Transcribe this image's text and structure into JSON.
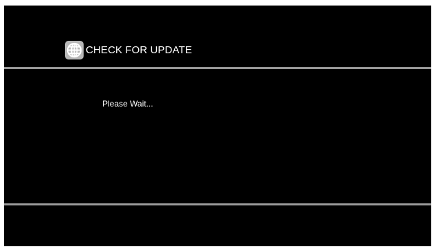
{
  "header": {
    "icon": "globe-icon",
    "title": "CHECK FOR UPDATE"
  },
  "content": {
    "status": "Please Wait..."
  },
  "colors": {
    "background": "#000000",
    "divider": "#9a9a9a",
    "text": "#ffffff",
    "icon_badge": "#b8b8b8"
  }
}
